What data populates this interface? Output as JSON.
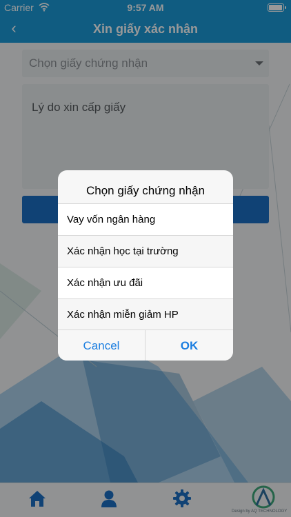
{
  "status_bar": {
    "carrier": "Carrier",
    "time": "9:57 AM",
    "wifi_icon": "wifi-icon",
    "battery_icon": "battery-icon"
  },
  "header": {
    "back_icon": "chevron-left-icon",
    "back_glyph": "‹",
    "title": "Xin giấy xác nhận"
  },
  "form": {
    "certificate_select": {
      "placeholder": "Chọn giấy chứng nhận",
      "caret_icon": "caret-down-icon"
    },
    "reason_field": {
      "placeholder": "Lý do xin cấp giấy"
    }
  },
  "dialog": {
    "title": "Chọn giấy chứng nhận",
    "options": [
      "Vay vốn ngân hàng",
      "Xác nhận học tại trường",
      "Xác nhận ưu đãi",
      "Xác nhận miễn giảm HP"
    ],
    "cancel_label": "Cancel",
    "ok_label": "OK"
  },
  "tab_bar": {
    "items": [
      {
        "icon": "home-icon"
      },
      {
        "icon": "user-icon"
      },
      {
        "icon": "gear-icon"
      }
    ],
    "logo_icon": "logo-icon",
    "logo_text": "Design by AQ TECHNOLOGY"
  },
  "colors": {
    "brand": "#1c9ad8",
    "submit": "#1c6fc4",
    "dialog_button": "#1b7ee0"
  }
}
